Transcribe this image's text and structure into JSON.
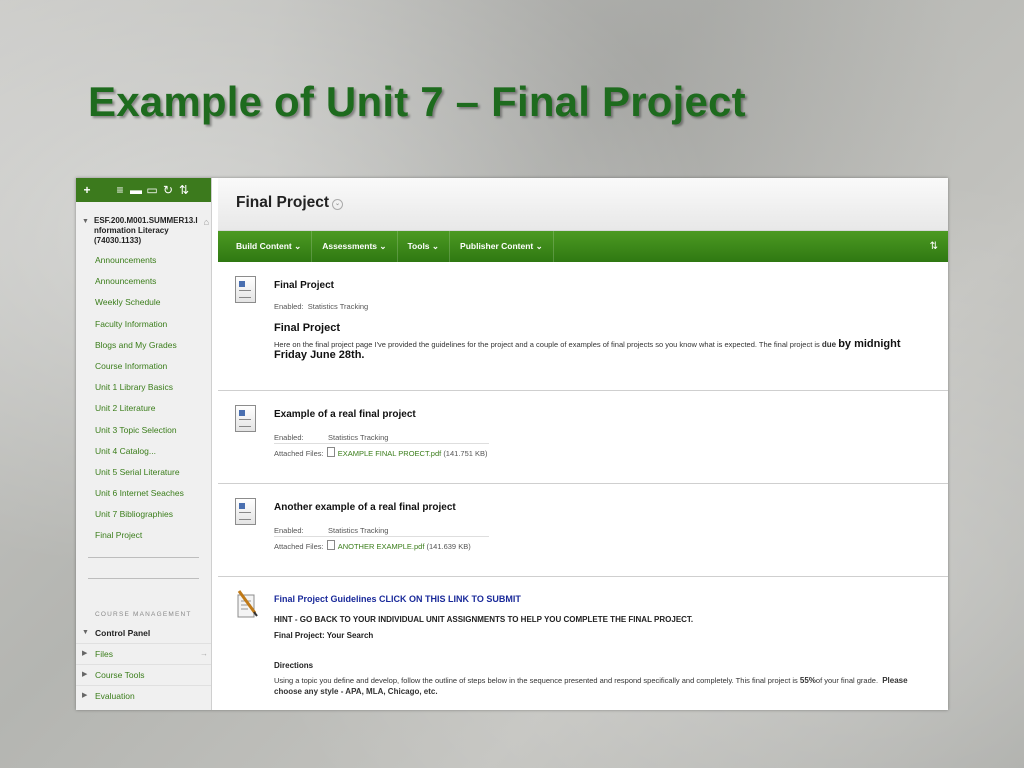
{
  "slide": {
    "title": "Example of Unit 7 – Final Project"
  },
  "sidebar": {
    "toolbar": {
      "add": "+",
      "list_icon": "≡",
      "folder_icon": "▬",
      "window_icon": "▭",
      "refresh_icon": "↻",
      "sort_icon": "⇅"
    },
    "course_title": "ESF.200.M001.SUMMER13.I nformation Literacy (74030.1133)",
    "items": [
      "Announcements",
      "Announcements",
      "Weekly Schedule",
      "Faculty Information",
      "Blogs and My Grades",
      "Course Information",
      "Unit 1 Library Basics",
      "Unit 2 Literature",
      "Unit 3 Topic Selection",
      "Unit 4 Catalog...",
      "Unit 5 Serial Literature",
      "Unit 6 Internet Seaches",
      "Unit 7 Bibliographies",
      "Final Project"
    ],
    "management_label": "COURSE MANAGEMENT",
    "control_panel": "Control Panel",
    "sub_items": [
      "Files",
      "Course Tools",
      "Evaluation"
    ]
  },
  "main": {
    "page_title": "Final Project",
    "menu": [
      "Build Content ⌄",
      "Assessments ⌄",
      "Tools ⌄",
      "Publisher Content ⌄"
    ],
    "sort_label": "⇅",
    "item1": {
      "title": "Final Project",
      "enabled_label": "Enabled:",
      "enabled_value": "Statistics Tracking",
      "heading": "Final Project",
      "body": "Here on the final project page I've provided the guidelines for the project and a couple of examples of final projects so you know what is expected. The final project is",
      "due": "due",
      "deadline": "by midnight Friday June 28th."
    },
    "item2": {
      "title": "Example of a real final project",
      "enabled_label": "Enabled:",
      "enabled_value": "Statistics Tracking",
      "files_label": "Attached Files:",
      "file_name": "EXAMPLE FINAL PROECT.pdf",
      "file_size": "(141.751 KB)"
    },
    "item3": {
      "title": "Another example of a real final project",
      "enabled_label": "Enabled:",
      "enabled_value": "Statistics Tracking",
      "files_label": "Attached Files:",
      "file_name": "ANOTHER EXAMPLE.pdf",
      "file_size": "(141.639 KB)"
    },
    "item4": {
      "title": "Final Project Guidelines CLICK ON THIS LINK TO SUBMIT",
      "hint": "HINT - GO BACK TO YOUR INDIVIDUAL UNIT ASSIGNMENTS TO HELP YOU COMPLETE THE FINAL PROJECT.",
      "subtitle": "Final Project: Your Search",
      "directions_label": "Directions",
      "directions_body": "Using a topic you define and develop, follow the outline of steps below in the sequence presented and respond specifically and completely. This final project is",
      "percent": "55%",
      "directions_rest": "of your final grade.",
      "style_note": "Please choose any style - APA, MLA, Chicago, etc."
    }
  }
}
